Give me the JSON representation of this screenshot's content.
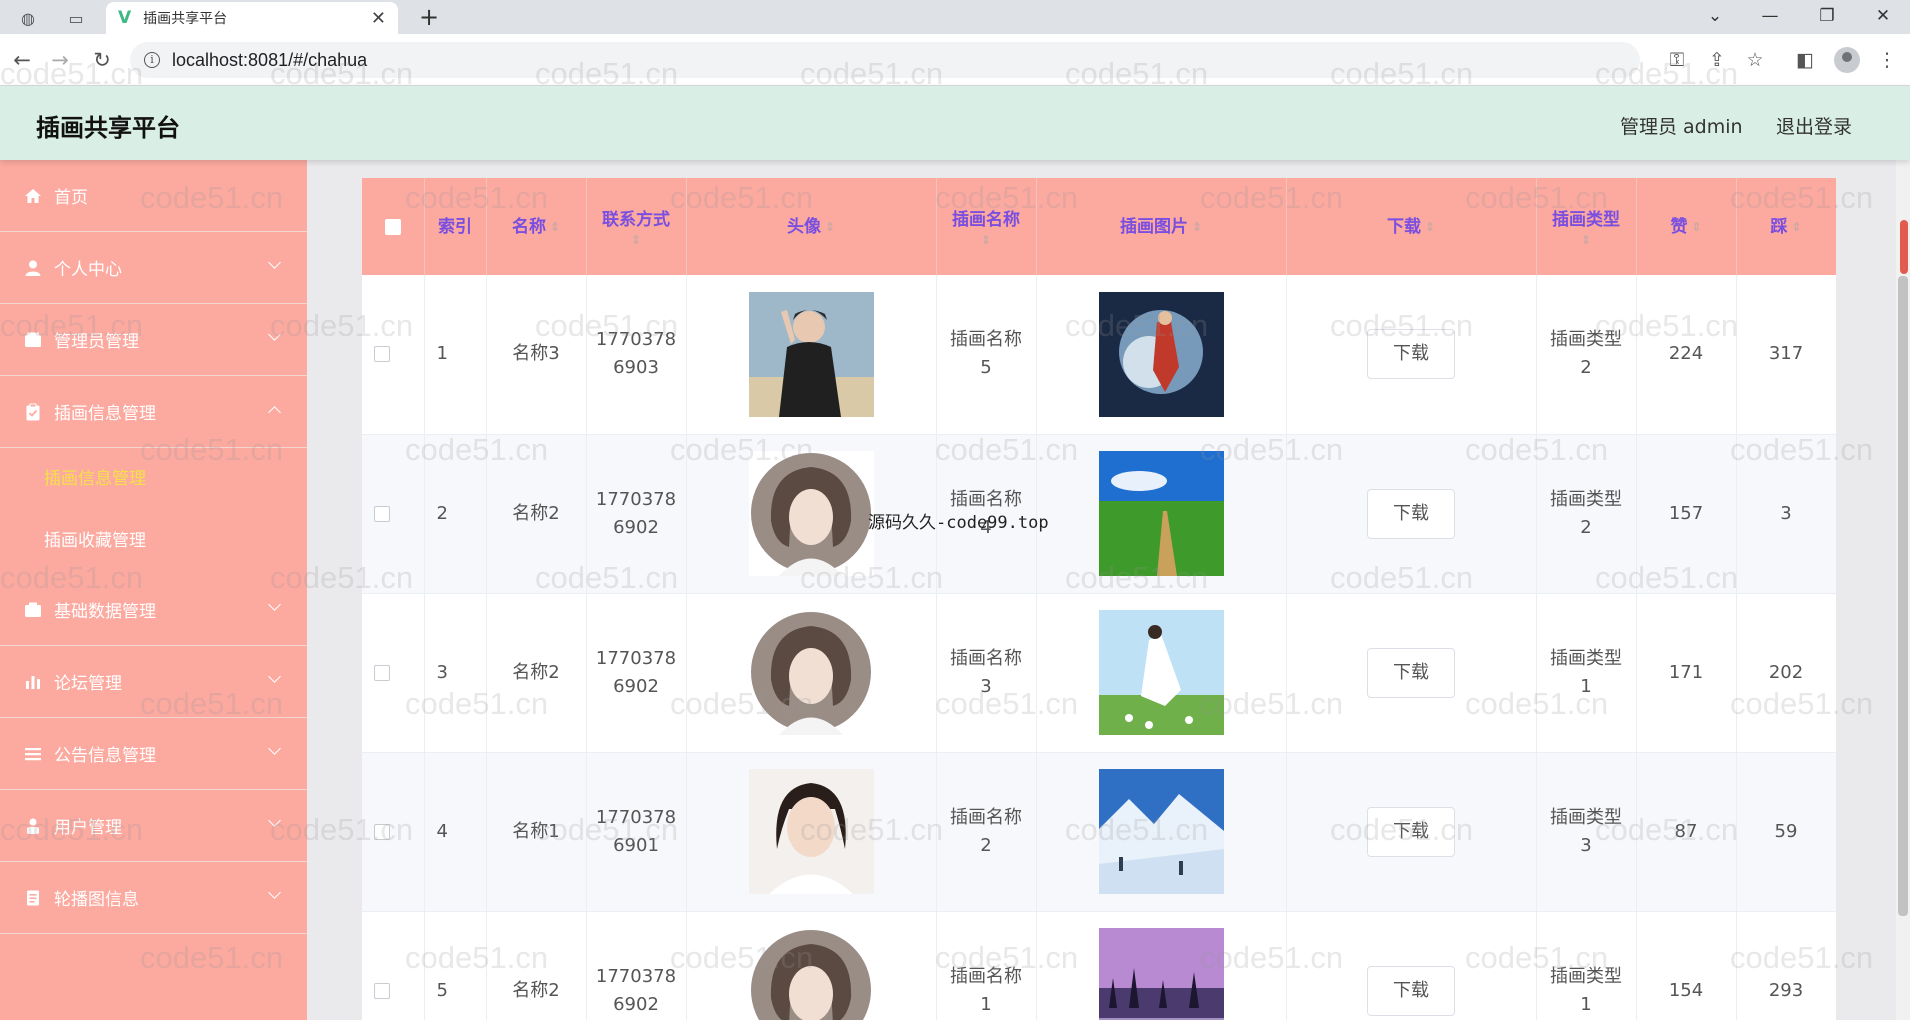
{
  "browser": {
    "tab_title": "插画共享平台",
    "url": "localhost:8081/#/chahua"
  },
  "header": {
    "title": "插画共享平台",
    "admin": "管理员 admin",
    "logout": "退出登录"
  },
  "sidebar": {
    "items": [
      {
        "label": "首页",
        "icon": "home-icon"
      },
      {
        "label": "个人中心",
        "icon": "user-icon"
      },
      {
        "label": "管理员管理",
        "icon": "wallet-icon"
      },
      {
        "label": "插画信息管理",
        "icon": "clipboard-icon"
      },
      {
        "label": "基础数据管理",
        "icon": "box-icon"
      },
      {
        "label": "论坛管理",
        "icon": "bar-chart-icon"
      },
      {
        "label": "公告信息管理",
        "icon": "list-icon"
      },
      {
        "label": "用户管理",
        "icon": "person-icon"
      },
      {
        "label": "轮播图信息",
        "icon": "document-icon"
      }
    ],
    "sub_items": [
      {
        "label": "插画信息管理"
      },
      {
        "label": "插画收藏管理"
      }
    ],
    "active_sub_color": "#f5e04a"
  },
  "table": {
    "headers": {
      "index": "索引",
      "name": "名称",
      "contact": "联系方式",
      "avatar": "头像",
      "illust_name": "插画名称",
      "illust_image": "插画图片",
      "download": "下载",
      "illust_type": "插画类型",
      "likes": "赞",
      "dislikes": "踩"
    },
    "download_label": "下载",
    "rows": [
      {
        "index": "1",
        "name": "名称3",
        "contact_a": "1770378",
        "contact_b": "6903",
        "illust_a": "插画名称",
        "illust_b": "5",
        "type_a": "插画类型",
        "type_b": "2",
        "likes": "224",
        "dislikes": "317"
      },
      {
        "index": "2",
        "name": "名称2",
        "contact_a": "1770378",
        "contact_b": "6902",
        "illust_a": "插画名称",
        "illust_b": "4",
        "type_a": "插画类型",
        "type_b": "2",
        "likes": "157",
        "dislikes": "3"
      },
      {
        "index": "3",
        "name": "名称2",
        "contact_a": "1770378",
        "contact_b": "6902",
        "illust_a": "插画名称",
        "illust_b": "3",
        "type_a": "插画类型",
        "type_b": "1",
        "likes": "171",
        "dislikes": "202"
      },
      {
        "index": "4",
        "name": "名称1",
        "contact_a": "1770378",
        "contact_b": "6901",
        "illust_a": "插画名称",
        "illust_b": "2",
        "type_a": "插画类型",
        "type_b": "3",
        "likes": "87",
        "dislikes": "59"
      },
      {
        "index": "5",
        "name": "名称2",
        "contact_a": "1770378",
        "contact_b": "6902",
        "illust_a": "插画名称",
        "illust_b": "1",
        "type_a": "插画类型",
        "type_b": "1",
        "likes": "154",
        "dislikes": "293"
      }
    ]
  },
  "overlay_text": "源码久久-code99.top",
  "watermark": "code51.cn",
  "colors": {
    "sidebar_bg": "#fcaaa0",
    "header_bg": "#d9efe5",
    "table_header_bg": "#fcaaa0",
    "table_header_text": "#7a4fe0"
  }
}
